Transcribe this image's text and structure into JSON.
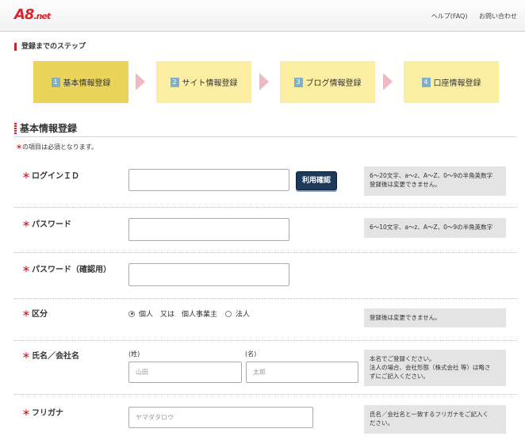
{
  "header": {
    "logo_main": "A8",
    "logo_suffix": ".net",
    "links": [
      "ヘルプ(FAQ)",
      "お問い合わせ"
    ]
  },
  "steps_title": "登録までのステップ",
  "steps": [
    {
      "num": "1",
      "label": "基本情報登録",
      "active": true
    },
    {
      "num": "2",
      "label": "サイト情報登録",
      "active": false
    },
    {
      "num": "3",
      "label": "ブログ情報登録",
      "active": false
    },
    {
      "num": "4",
      "label": "口座情報登録",
      "active": false
    }
  ],
  "section_title": "基本情報登録",
  "required_mark": "＊",
  "required_note": "の項目は必須となります。",
  "form": {
    "login_id": {
      "label": "ログインＩＤ",
      "value": "",
      "check_button": "利用確認",
      "help": [
        "6～20文字、a～z、A～Z、0～9の半角英数字",
        "登録後は変更できません。"
      ]
    },
    "password": {
      "label": "パスワード",
      "value": "",
      "help": [
        "6～10文字、a～z、A～Z、0～9の半角英数字"
      ]
    },
    "password_confirm": {
      "label": "パスワード（確認用）",
      "value": ""
    },
    "category": {
      "label": "区分",
      "options": [
        {
          "label": "個人　又は　個人事業主",
          "selected": true
        },
        {
          "label": "法人",
          "selected": false
        }
      ],
      "help": [
        "登録後は変更できません。"
      ]
    },
    "name": {
      "label": "氏名／会社名",
      "last_label": "(姓)",
      "first_label": "(名)",
      "last_placeholder": "山田",
      "first_placeholder": "太郎",
      "help": [
        "本名でご登録ください。",
        "法人の場合、会社形態（株式会社 等）は略さ",
        "ずにご記入ください。"
      ]
    },
    "furigana": {
      "label": "フリガナ",
      "placeholder": "ヤマダタロウ",
      "help": [
        "氏名／会社名と一致するフリガナをご記入く",
        "ださい。"
      ]
    }
  }
}
